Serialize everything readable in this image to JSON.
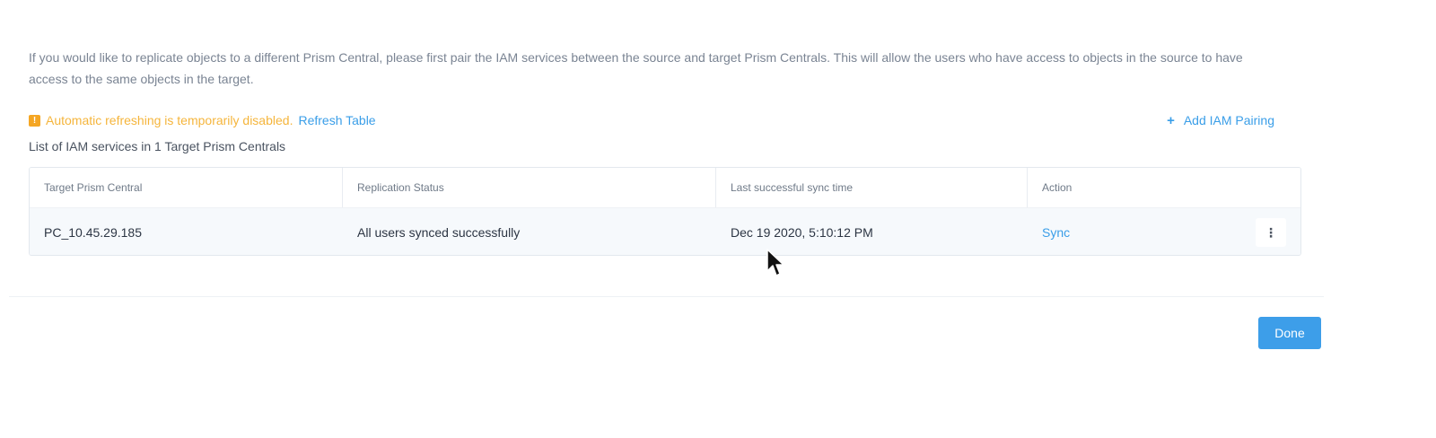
{
  "description": "If you would like to replicate objects to a different Prism Central, please first pair the IAM services between the source and target Prism Centrals. This will allow the users who have access to objects in the source to have access to the same objects in the target.",
  "warning": {
    "icon": "!",
    "text": "Automatic refreshing is temporarily disabled.",
    "refresh_label": "Refresh Table",
    "color": "#f5b53c"
  },
  "add_pairing": {
    "icon": "+",
    "label": "Add IAM Pairing"
  },
  "list_title": "List of IAM services in 1 Target Prism Centrals",
  "table": {
    "headers": [
      "Target Prism Central",
      "Replication Status",
      "Last successful sync time",
      "Action"
    ],
    "rows": [
      {
        "target": "PC_10.45.29.185",
        "status": "All users synced successfully",
        "last_sync": "Dec 19 2020, 5:10:12 PM",
        "action": "Sync",
        "more_icon": "⋮"
      }
    ]
  },
  "done_label": "Done",
  "accent_color": "#3a9ee8"
}
